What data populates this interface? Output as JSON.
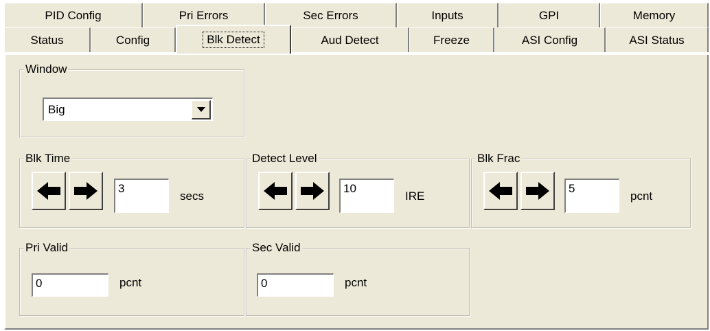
{
  "tabs": {
    "top": [
      "PID Config",
      "Pri Errors",
      "Sec Errors",
      "Inputs",
      "GPI",
      "Memory"
    ],
    "bottom": [
      "Status",
      "Config",
      "Blk Detect",
      "Aud Detect",
      "Freeze",
      "ASI Config",
      "ASI Status"
    ],
    "active": "Blk Detect"
  },
  "window_group": {
    "title": "Window",
    "selected": "Big"
  },
  "blk_time": {
    "title": "Blk Time",
    "value": "3",
    "unit": "secs"
  },
  "detect_level": {
    "title": "Detect Level",
    "value": "10",
    "unit": "IRE"
  },
  "blk_frac": {
    "title": "Blk Frac",
    "value": "5",
    "unit": "pcnt"
  },
  "pri_valid": {
    "title": "Pri Valid",
    "value": "0",
    "unit": "pcnt"
  },
  "sec_valid": {
    "title": "Sec Valid",
    "value": "0",
    "unit": "pcnt"
  }
}
